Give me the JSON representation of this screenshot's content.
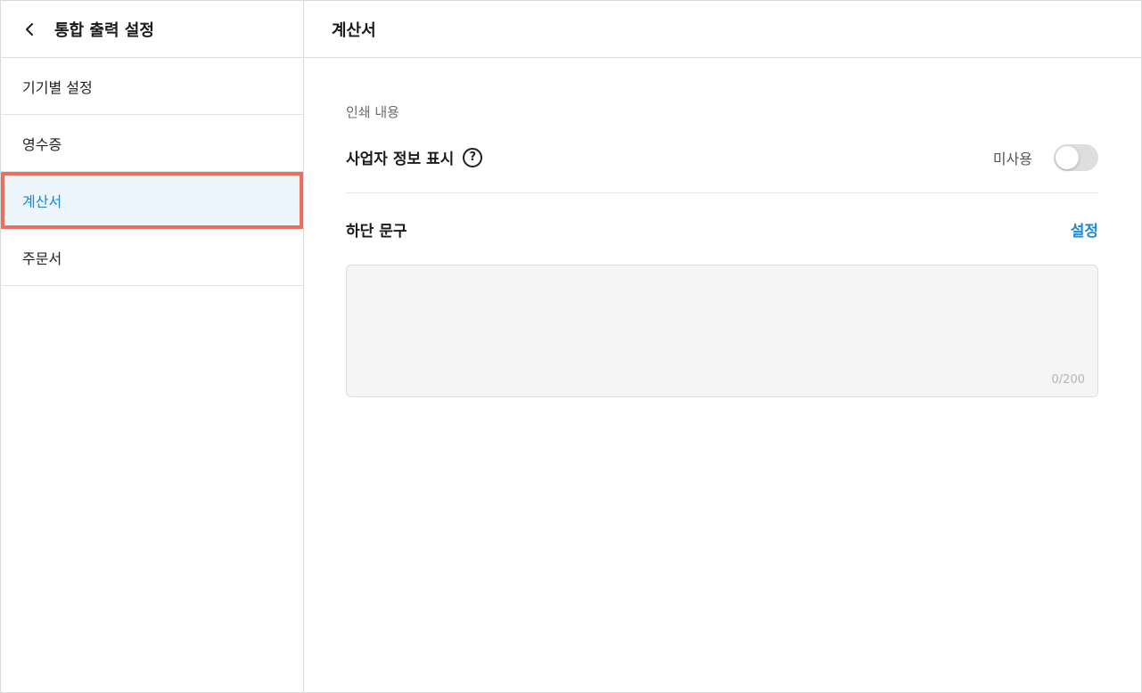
{
  "sidebar": {
    "back_icon": "chevron-left-icon",
    "title": "통합 출력 설정",
    "items": [
      {
        "label": "기기별 설정",
        "active": false
      },
      {
        "label": "영수증",
        "active": false
      },
      {
        "label": "계산서",
        "active": true
      },
      {
        "label": "주문서",
        "active": false
      }
    ]
  },
  "main": {
    "title": "계산서",
    "section_label": "인쇄 내용",
    "business_info": {
      "label": "사업자 정보 표시",
      "help_icon": "question-circle-icon",
      "toggle_label": "미사용",
      "toggle_on": false
    },
    "footer_text": {
      "label": "하단 문구",
      "action_label": "설정",
      "value": "",
      "char_count": "0/200"
    }
  },
  "colors": {
    "accent": "#1a85d6",
    "highlight_border": "#ec6f5e",
    "active_bg": "#eef6fd"
  }
}
